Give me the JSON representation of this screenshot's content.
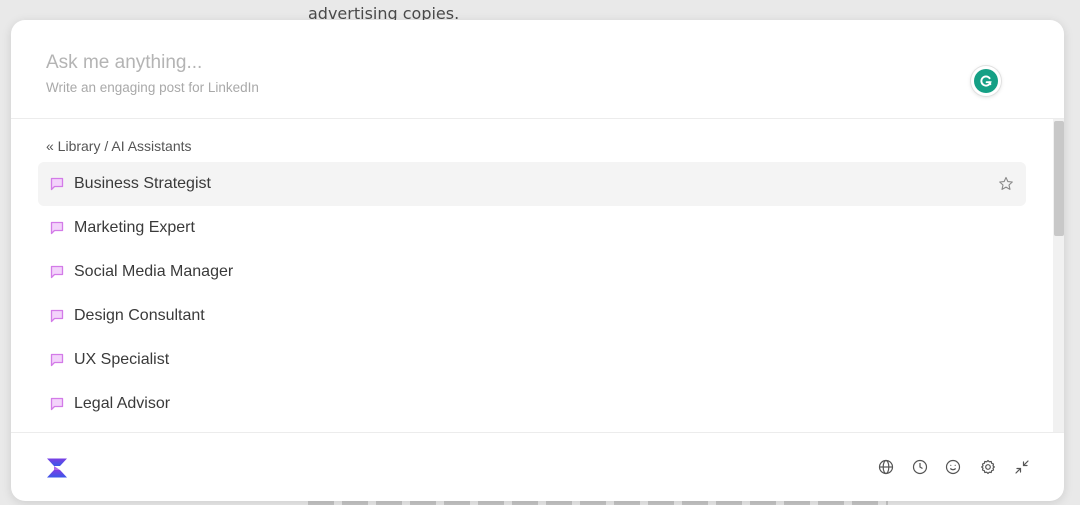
{
  "background": {
    "top_text": "advertising copies."
  },
  "search": {
    "placeholder": "Ask me anything...",
    "hint": "Write an engaging post for LinkedIn"
  },
  "breadcrumb": "« Library / AI Assistants",
  "assistants": [
    {
      "label": "Business Strategist",
      "active": true
    },
    {
      "label": "Marketing Expert"
    },
    {
      "label": "Social Media Manager"
    },
    {
      "label": "Design Consultant"
    },
    {
      "label": "UX Specialist"
    },
    {
      "label": "Legal Advisor"
    }
  ],
  "footer_icons": [
    "globe-icon",
    "history-icon",
    "smiley-icon",
    "gear-icon",
    "minimize-icon"
  ],
  "colors": {
    "chat_icon": "#d37be8",
    "grammarly": "#15a085",
    "logo_top": "#7b3fe4",
    "logo_bottom": "#3a57e8"
  }
}
